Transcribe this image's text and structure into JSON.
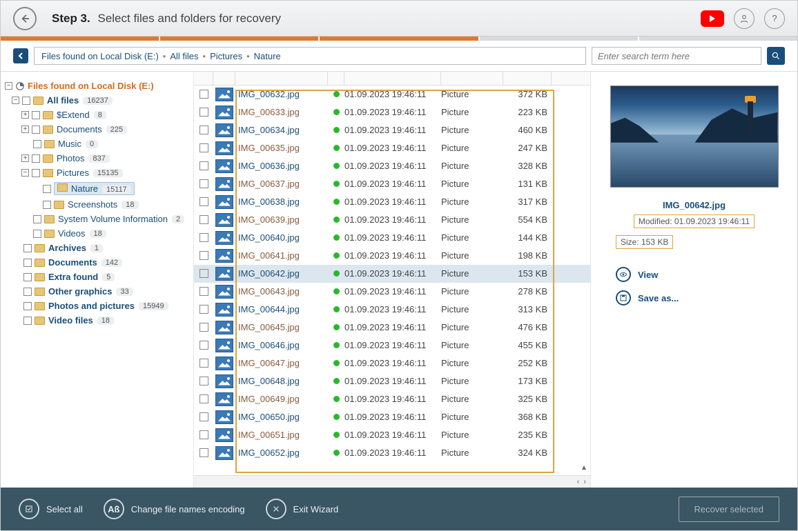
{
  "header": {
    "step": "Step 3.",
    "title": "Select files and folders for recovery"
  },
  "breadcrumb": {
    "root": "Files found on Local Disk (E:)",
    "parts": [
      "All files",
      "Pictures",
      "Nature"
    ]
  },
  "search": {
    "placeholder": "Enter search term here"
  },
  "tree": {
    "root": {
      "label": "Files found on Local Disk (E:)"
    },
    "all_files": {
      "label": "All files",
      "count": "16237"
    },
    "extend": {
      "label": "$Extend",
      "count": "8"
    },
    "documents": {
      "label": "Documents",
      "count": "225"
    },
    "music": {
      "label": "Music",
      "count": "0"
    },
    "photos": {
      "label": "Photos",
      "count": "837"
    },
    "pictures": {
      "label": "Pictures",
      "count": "15135"
    },
    "nature": {
      "label": "Nature",
      "count": "15117"
    },
    "screenshots": {
      "label": "Screenshots",
      "count": "18"
    },
    "svi": {
      "label": "System Volume Information",
      "count": "2"
    },
    "videos": {
      "label": "Videos",
      "count": "18"
    },
    "archives": {
      "label": "Archives",
      "count": "1"
    },
    "documents2": {
      "label": "Documents",
      "count": "142"
    },
    "extra": {
      "label": "Extra found",
      "count": "5"
    },
    "other_gfx": {
      "label": "Other graphics",
      "count": "33"
    },
    "photos_pics": {
      "label": "Photos and pictures",
      "count": "15949"
    },
    "video_files": {
      "label": "Video files",
      "count": "18"
    }
  },
  "files": [
    {
      "name": "IMG_00632.jpg",
      "date": "01.09.2023 19:46:11",
      "type": "Picture",
      "size": "372 KB",
      "odd": false
    },
    {
      "name": "IMG_00633.jpg",
      "date": "01.09.2023 19:46:11",
      "type": "Picture",
      "size": "223 KB",
      "odd": true
    },
    {
      "name": "IMG_00634.jpg",
      "date": "01.09.2023 19:46:11",
      "type": "Picture",
      "size": "460 KB",
      "odd": false
    },
    {
      "name": "IMG_00635.jpg",
      "date": "01.09.2023 19:46:11",
      "type": "Picture",
      "size": "247 KB",
      "odd": true
    },
    {
      "name": "IMG_00636.jpg",
      "date": "01.09.2023 19:46:11",
      "type": "Picture",
      "size": "328 KB",
      "odd": false
    },
    {
      "name": "IMG_00637.jpg",
      "date": "01.09.2023 19:46:11",
      "type": "Picture",
      "size": "131 KB",
      "odd": true
    },
    {
      "name": "IMG_00638.jpg",
      "date": "01.09.2023 19:46:11",
      "type": "Picture",
      "size": "317 KB",
      "odd": false
    },
    {
      "name": "IMG_00639.jpg",
      "date": "01.09.2023 19:46:11",
      "type": "Picture",
      "size": "554 KB",
      "odd": true
    },
    {
      "name": "IMG_00640.jpg",
      "date": "01.09.2023 19:46:11",
      "type": "Picture",
      "size": "144 KB",
      "odd": false
    },
    {
      "name": "IMG_00641.jpg",
      "date": "01.09.2023 19:46:11",
      "type": "Picture",
      "size": "198 KB",
      "odd": true
    },
    {
      "name": "IMG_00642.jpg",
      "date": "01.09.2023 19:46:11",
      "type": "Picture",
      "size": "153 KB",
      "odd": false,
      "selected": true
    },
    {
      "name": "IMG_00643.jpg",
      "date": "01.09.2023 19:46:11",
      "type": "Picture",
      "size": "278 KB",
      "odd": true
    },
    {
      "name": "IMG_00644.jpg",
      "date": "01.09.2023 19:46:11",
      "type": "Picture",
      "size": "313 KB",
      "odd": false
    },
    {
      "name": "IMG_00645.jpg",
      "date": "01.09.2023 19:46:11",
      "type": "Picture",
      "size": "476 KB",
      "odd": true
    },
    {
      "name": "IMG_00646.jpg",
      "date": "01.09.2023 19:46:11",
      "type": "Picture",
      "size": "455 KB",
      "odd": false
    },
    {
      "name": "IMG_00647.jpg",
      "date": "01.09.2023 19:46:11",
      "type": "Picture",
      "size": "252 KB",
      "odd": true
    },
    {
      "name": "IMG_00648.jpg",
      "date": "01.09.2023 19:46:11",
      "type": "Picture",
      "size": "173 KB",
      "odd": false
    },
    {
      "name": "IMG_00649.jpg",
      "date": "01.09.2023 19:46:11",
      "type": "Picture",
      "size": "325 KB",
      "odd": true
    },
    {
      "name": "IMG_00650.jpg",
      "date": "01.09.2023 19:46:11",
      "type": "Picture",
      "size": "368 KB",
      "odd": false
    },
    {
      "name": "IMG_00651.jpg",
      "date": "01.09.2023 19:46:11",
      "type": "Picture",
      "size": "235 KB",
      "odd": true
    },
    {
      "name": "IMG_00652.jpg",
      "date": "01.09.2023 19:46:11",
      "type": "Picture",
      "size": "324 KB",
      "odd": false
    }
  ],
  "preview": {
    "name": "IMG_00642.jpg",
    "modified": "Modified: 01.09.2023 19:46:11",
    "size": "Size: 153 KB",
    "view": "View",
    "save": "Save as..."
  },
  "footer": {
    "select_all": "Select all",
    "encoding": "Change file names encoding",
    "exit": "Exit Wizard",
    "recover": "Recover selected"
  }
}
